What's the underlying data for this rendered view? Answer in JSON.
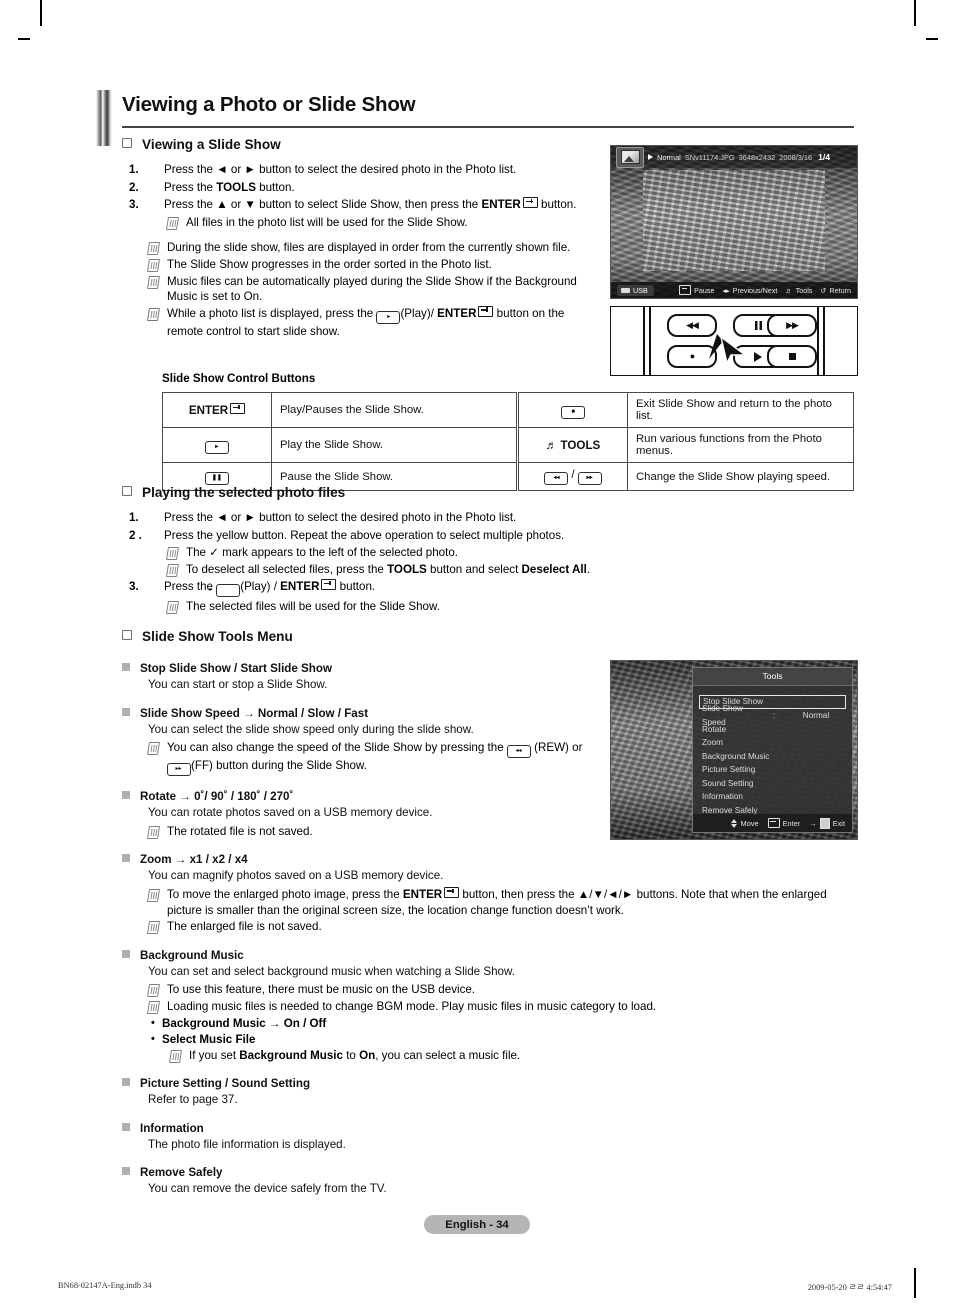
{
  "page": {
    "title": "Viewing a Photo or Slide Show",
    "footer_pill": "English - 34",
    "footer_left": "BN68-02147A-Eng.indb  34",
    "footer_right": "2009-05-20  ㄹㄹ 4:54:47"
  },
  "slide_show": {
    "heading": "Viewing a Slide Show",
    "steps": [
      {
        "n": "1.",
        "text_a": "Press the ◄ or ► button to select the desired photo in the Photo list."
      },
      {
        "n": "2.",
        "text_a": "Press the ",
        "bold_a": "TOOLS",
        "text_b": " button."
      },
      {
        "n": "3.",
        "text_a": "Press the ▲ or ▼ button to select Slide Show, then press the ",
        "bold_a": "ENTER",
        "text_b": " button."
      }
    ],
    "step3_note": "All files in the photo list will be used for the Slide Show.",
    "notes": [
      "During the slide show, files are displayed in order from the currently shown file.",
      "The Slide Show progresses in the order sorted in the Photo list.",
      "Music files can be automatically played during the Slide Show if the Background Music is set to On."
    ],
    "hand_note_a": "While a photo list is displayed, press the ",
    "hand_note_play": "(Play)/ ",
    "hand_note_enter": "ENTER",
    "hand_note_b": " button on the remote control to start slide show."
  },
  "control_buttons": {
    "caption": "Slide Show Control Buttons",
    "rows": [
      {
        "key_left": "ENTER",
        "key_left_type": "enter",
        "desc_left": "Play/Pauses the Slide Show.",
        "key_right": "stop",
        "key_right_type": "keycap",
        "desc_right": "Exit Slide Show and return to the photo list."
      },
      {
        "key_left": "play",
        "key_left_type": "keycap",
        "desc_left": "Play the Slide Show.",
        "key_right": "TOOLS",
        "key_right_type": "tools",
        "desc_right": "Run various functions from the Photo menus."
      },
      {
        "key_left": "pause",
        "key_left_type": "keycap",
        "desc_left": "Pause the Slide Show.",
        "key_right": "rew/ff",
        "key_right_type": "pair",
        "desc_right": "Change the  Slide Show playing speed."
      }
    ]
  },
  "selected_files": {
    "heading": "Playing the selected photo files",
    "step1": "Press the ◄ or ► button to select the desired photo in the Photo list.",
    "step1_n": "1.",
    "step2_n": "2 .",
    "step2": "Press the yellow button. Repeat the above operation to select multiple photos.",
    "step2_notes_a": "The ✓  mark appears to the left of the selected photo.",
    "step2_note_b_a": "To deselect all selected files, press the ",
    "step2_note_b_bold1": "TOOLS",
    "step2_note_b_mid": " button and select ",
    "step2_note_b_bold2": "Deselect All",
    "step2_note_b_end": ".",
    "step3_n": "3.",
    "step3_a": "Press the ",
    "step3_play": "(Play) / ",
    "step3_enter": "ENTER",
    "step3_b": " button.",
    "step3_note": "The selected files will be used for the Slide Show."
  },
  "tools_menu": {
    "heading": "Slide Show Tools Menu",
    "items": [
      {
        "title": "Stop Slide Show / Start Slide Show",
        "body": "You can start or stop a Slide Show."
      },
      {
        "title": "Slide Show Speed → Normal / Slow / Fast",
        "body": "You can select the slide show speed only during the slide show.",
        "note_a": "You can also change the speed of the Slide Show by pressing the ",
        "note_rew": " (REW) or ",
        "note_ff": "(FF) button during the Slide Show."
      },
      {
        "title": "Rotate → 0˚/ 90˚ / 180˚ / 270˚",
        "body": "You can rotate photos saved on a USB memory device.",
        "note": "The rotated file is not saved."
      },
      {
        "title": "Zoom → x1 / x2 / x4",
        "body": "You can magnify photos saved on a USB memory device.",
        "note_a": "To move the enlarged photo image, press the ",
        "note_enter": "ENTER",
        "note_b": " button, then press the ▲/▼/◄/► buttons. Note that when the enlarged picture is smaller than the original screen size, the location change function doesn’t work.",
        "note2": "The enlarged file is not saved."
      },
      {
        "title": "Background Music",
        "body": "You can set and select background music when watching a Slide Show.",
        "note1": "To use this feature, there must be music on the USB device.",
        "note2": "Loading music files is needed to change BGM mode. Play music files in music category to load.",
        "bullet1": "Background Music → On / Off",
        "bullet2": "Select Music File",
        "sub_note_a": "If you set ",
        "sub_note_bold1": "Background Music",
        "sub_note_mid": " to ",
        "sub_note_bold2": "On",
        "sub_note_end": ", you can select a music file."
      },
      {
        "title": "Picture Setting / Sound Setting",
        "body": "Refer to page 37."
      },
      {
        "title": "Information",
        "body": "The photo file information is displayed."
      },
      {
        "title": "Remove Safely",
        "body": "You can remove the device safely from the TV."
      }
    ]
  },
  "figure_photo_viewer": {
    "mode": "Normal",
    "filename": "SNv11174.JPG",
    "resolution": "3648x2432",
    "date": "2008/3/16",
    "counter": "1/4",
    "usb_label": "USB",
    "hint_pause": "Pause",
    "hint_prevnext": "Previous/Next",
    "hint_tools": "Tools",
    "hint_return": "Return"
  },
  "figure_tools_menu": {
    "title": "Tools",
    "rows": [
      {
        "label": "Stop Slide Show",
        "selected": true
      },
      {
        "label": "Slide Show Speed",
        "colon": ":",
        "value": "Normal"
      },
      {
        "label": "Rotate"
      },
      {
        "label": "Zoom"
      },
      {
        "label": "Background Music"
      },
      {
        "label": "Picture Setting"
      },
      {
        "label": "Sound Setting"
      },
      {
        "label": "Information"
      },
      {
        "label": "Remove Safely"
      }
    ],
    "foot_move": "Move",
    "foot_enter": "Enter",
    "foot_exit": "Exit"
  }
}
